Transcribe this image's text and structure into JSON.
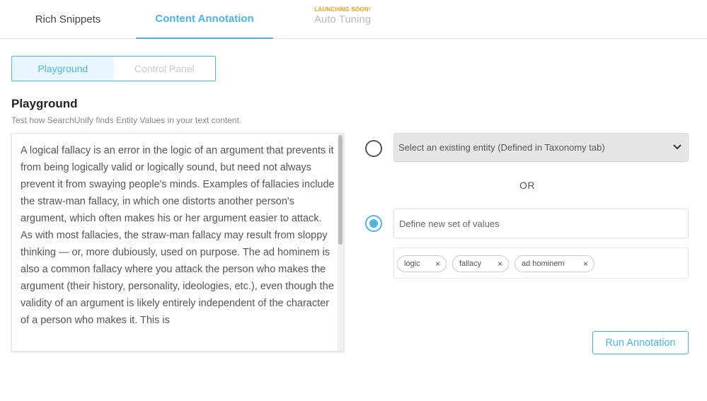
{
  "tabs": {
    "rich_snippets": "Rich Snippets",
    "content_annotation": "Content Annotation",
    "auto_tuning": "Auto Tuning",
    "launching_badge": "LAUNCHING SOON!"
  },
  "subtabs": {
    "playground": "Playground",
    "control_panel": "Control Panel"
  },
  "section": {
    "title": "Playground",
    "description": "Test how SearchUnify finds Entity Values in your text content."
  },
  "content_text": "A logical fallacy is an error in the logic of an argument that prevents it from being logically valid or logically sound, but need not always prevent it from swaying people's minds. Examples of fallacies include the straw-man fallacy, in which one distorts another person's argument, which often makes his or her argument easier to attack. As with most fallacies, the straw-man fallacy may result from sloppy thinking — or, more dubiously, used on purpose. The ad hominem is also a common fallacy where you attack the person who makes the argument (their history, personality, ideologies, etc.), even though the validity of an argument is likely entirely independent of the character of a person who makes it. This is",
  "entity_select": {
    "label": "Select an existing entity (Defined in Taxonomy tab)",
    "icon": "chevron-down-icon"
  },
  "or_label": "OR",
  "values_input": {
    "placeholder": "Define new set of values",
    "value": ""
  },
  "chips": [
    {
      "label": "logic",
      "remove": "×"
    },
    {
      "label": "fallacy",
      "remove": "×"
    },
    {
      "label": "ad hominem",
      "remove": "×"
    }
  ],
  "run_button": "Run Annotation",
  "colors": {
    "accent": "#4ab5ea",
    "badge": "#f59a23"
  }
}
